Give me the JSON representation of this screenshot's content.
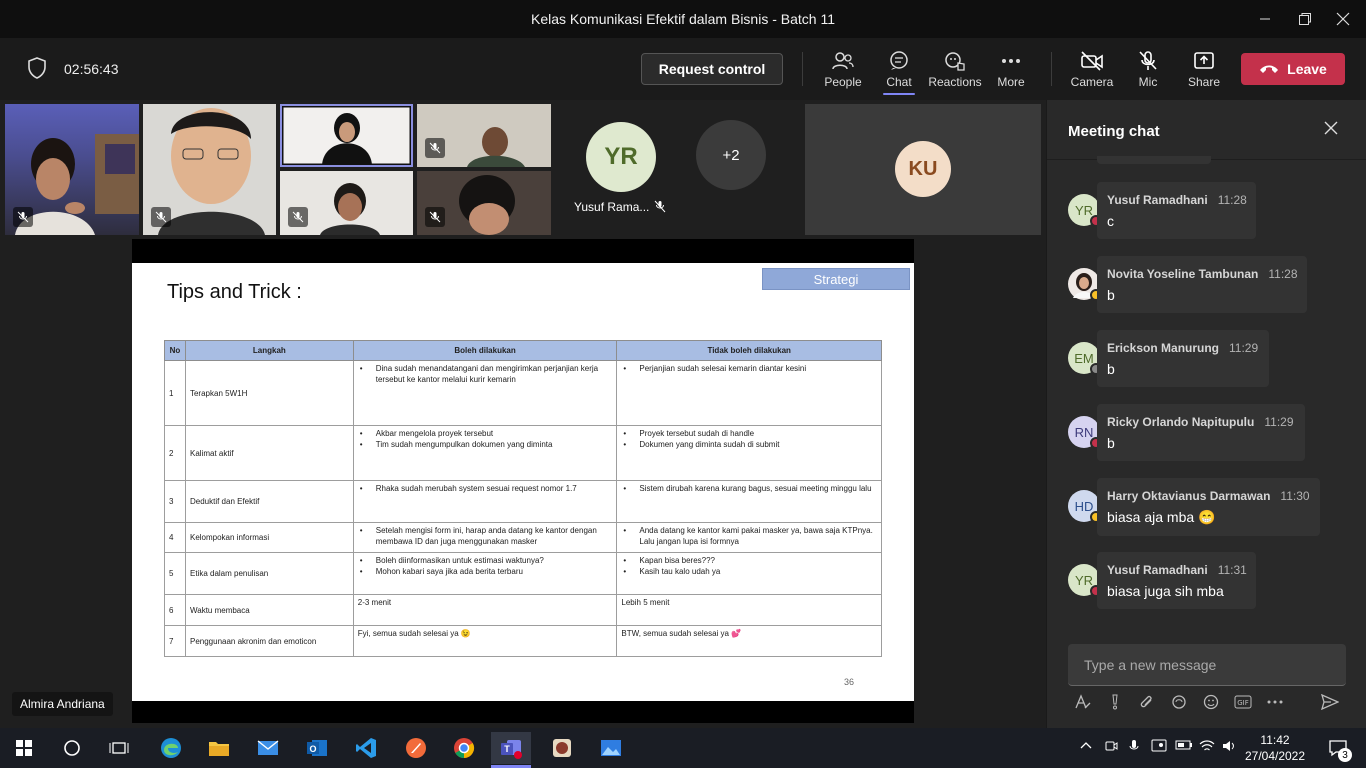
{
  "window": {
    "title": "Kelas Komunikasi Efektif dalam Bisnis - Batch 11"
  },
  "toolbar": {
    "timer": "02:56:43",
    "request_control": "Request control",
    "people": "People",
    "chat": "Chat",
    "reactions": "Reactions",
    "more": "More",
    "camera": "Camera",
    "mic": "Mic",
    "share": "Share",
    "leave": "Leave"
  },
  "participants": {
    "yr_initials": "YR",
    "yr_name": "Yusuf Rama...",
    "overflow": "+2",
    "ku_initials": "KU",
    "presenter_name": "Almira Andriana"
  },
  "slide": {
    "title": "Tips and Trick :",
    "tag": "Strategi",
    "page": "36",
    "headers": [
      "No",
      "Langkah",
      "Boleh dilakukan",
      "Tidak boleh dilakukan"
    ],
    "rows": [
      {
        "no": "1",
        "step": "Terapkan 5W1H",
        "do": [
          "Dina sudah menandatangani dan mengirimkan perjanjian kerja tersebut ke kantor melalui kurir kemarin"
        ],
        "dont": [
          "Perjanjian sudah selesai kemarin diantar kesini"
        ]
      },
      {
        "no": "2",
        "step": "Kalimat aktif",
        "do": [
          "Akbar mengelola proyek tersebut",
          "Tim sudah mengumpulkan dokumen yang diminta"
        ],
        "dont": [
          "Proyek tersebut sudah di handle",
          "Dokumen yang diminta sudah di submit"
        ]
      },
      {
        "no": "3",
        "step": "Deduktif dan Efektif",
        "do": [
          "Rhaka sudah merubah system sesuai request nomor 1.7"
        ],
        "dont": [
          "Sistem dirubah karena kurang bagus, sesuai meeting minggu lalu"
        ]
      },
      {
        "no": "4",
        "step": "Kelompokan informasi",
        "do": [
          "Setelah mengisi form ini, harap anda datang ke kantor dengan membawa ID dan juga menggunakan masker"
        ],
        "dont": [
          "Anda datang ke kantor kami pakai masker ya, bawa saja KTPnya. Lalu jangan lupa isi formnya"
        ]
      },
      {
        "no": "5",
        "step": "Etika dalam penulisan",
        "do": [
          "Boleh diinformasikan untuk estimasi waktunya?",
          "Mohon kabari saya jika ada berita terbaru"
        ],
        "dont": [
          "Kapan bisa beres???",
          "Kasih tau kalo udah ya"
        ]
      },
      {
        "no": "6",
        "step": "Waktu membaca",
        "do_text": "2-3 menit",
        "dont_text": "Lebih  5 menit"
      },
      {
        "no": "7",
        "step": "Penggunaan akronim dan emoticon",
        "do_text": "Fyi, semua sudah selesai ya 😉",
        "dont_text": "BTW, semua sudah selesai ya 💕"
      }
    ]
  },
  "chat": {
    "title": "Meeting chat",
    "input_placeholder": "Type a new message",
    "messages": [
      {
        "initials": "YR",
        "name": "Yusuf Ramadhani",
        "time": "11:28",
        "text": "c",
        "avatar_color": "#d9e6c8",
        "initials_color": "#4f6b2a",
        "status_color": "#c4314b"
      },
      {
        "initials": "",
        "name": "Novita Yoseline Tambunan",
        "time": "11:28",
        "text": "b",
        "avatar_color": "#e9d7d0",
        "initials_color": "#333",
        "status_color": "#f8c027"
      },
      {
        "initials": "EM",
        "name": "Erickson Manurung",
        "time": "11:29",
        "text": "b",
        "avatar_color": "#d9e6c8",
        "initials_color": "#4f6b2a",
        "status_color": "#8a8a8a"
      },
      {
        "initials": "RN",
        "name": "Ricky Orlando Napitupulu",
        "time": "11:29",
        "text": "b",
        "avatar_color": "#d6d3f0",
        "initials_color": "#3d3a7a",
        "status_color": "#c4314b"
      },
      {
        "initials": "HD",
        "name": "Harry Oktavianus Darmawan",
        "time": "11:30",
        "text": "biasa aja mba 😁",
        "avatar_color": "#cfd9ee",
        "initials_color": "#2e4f8c",
        "status_color": "#f8c027"
      },
      {
        "initials": "YR",
        "name": "Yusuf Ramadhani",
        "time": "11:31",
        "text": "biasa juga sih mba",
        "avatar_color": "#d9e6c8",
        "initials_color": "#4f6b2a",
        "status_color": "#c4314b"
      }
    ]
  },
  "taskbar": {
    "time": "11:42",
    "date": "27/04/2022",
    "notifications": "3"
  }
}
